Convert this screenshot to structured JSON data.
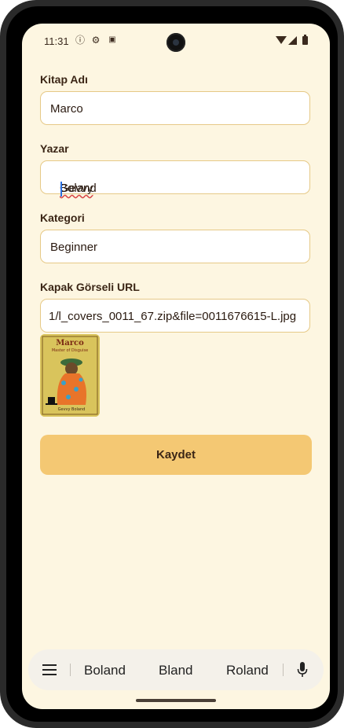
{
  "status_bar": {
    "time": "11:31"
  },
  "form": {
    "book_name": {
      "label": "Kitap Adı",
      "value": "Marco"
    },
    "author": {
      "label": "Yazar",
      "value_misspelled": "Gevvy",
      "value_rest": " Boland"
    },
    "category": {
      "label": "Kategori",
      "value": "Beginner"
    },
    "cover_url": {
      "label": "Kapak Görseli URL",
      "value": "1/l_covers_0011_67.zip&file=0011676615-L.jpg"
    },
    "cover_preview": {
      "title": "Marco",
      "subtitle": "Master of Disguise",
      "author": "Gevvy Boland"
    },
    "save_label": "Kaydet"
  },
  "keyboard": {
    "suggestions": [
      "Boland",
      "Bland",
      "Roland"
    ]
  },
  "colors": {
    "background": "#fdf6e1",
    "field_border": "#e6c987",
    "button": "#f4c873",
    "text": "#3b2616"
  }
}
